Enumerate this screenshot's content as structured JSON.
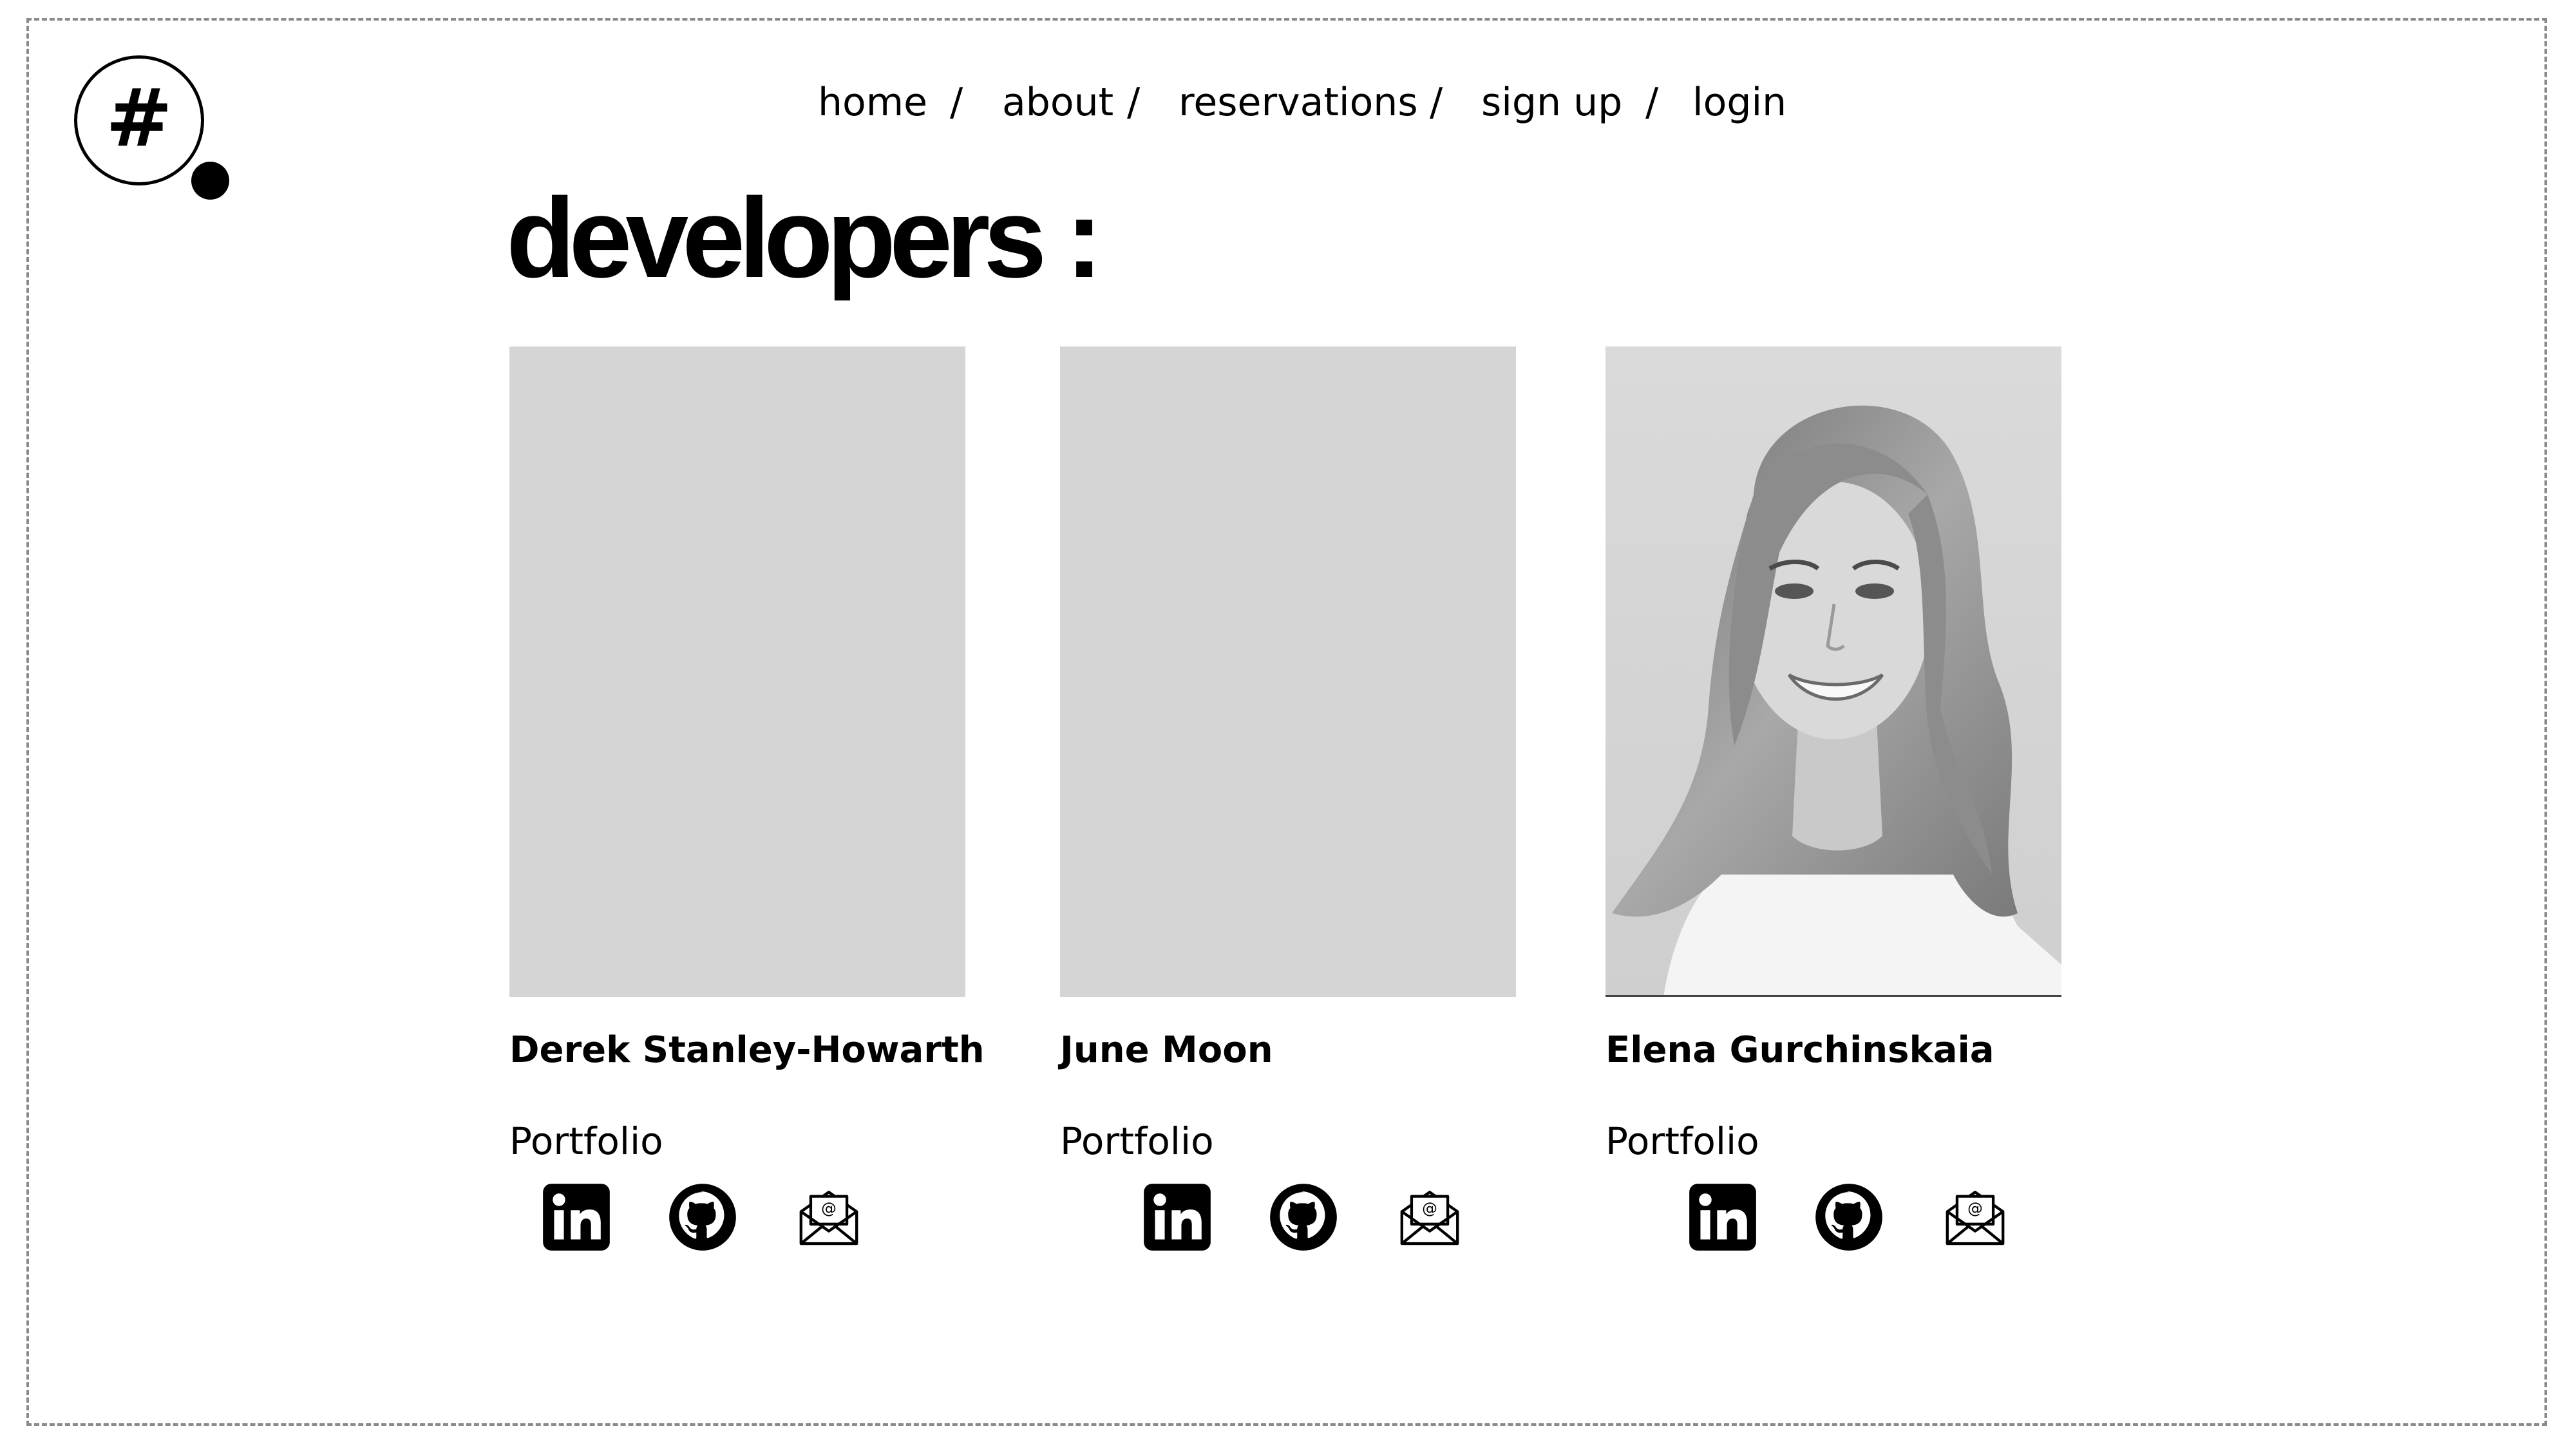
{
  "logo": {
    "symbol": "#"
  },
  "nav": {
    "items": [
      "home",
      "about",
      "reservations",
      "sign up",
      "login"
    ],
    "separator": "/"
  },
  "page_title": "developers :",
  "developers": [
    {
      "name": "Derek Stanley-Howarth",
      "portfolio_label": "Portfolio",
      "has_photo": false
    },
    {
      "name": "June Moon",
      "portfolio_label": "Portfolio",
      "has_photo": false
    },
    {
      "name": "Elena Gurchinskaia",
      "portfolio_label": "Portfolio",
      "has_photo": true
    }
  ],
  "social_icons": [
    "linkedin-icon",
    "github-icon",
    "email-icon"
  ],
  "colors": {
    "placeholder": "#d5d5d5",
    "text": "#000000",
    "frame": "#8a8a8a"
  }
}
